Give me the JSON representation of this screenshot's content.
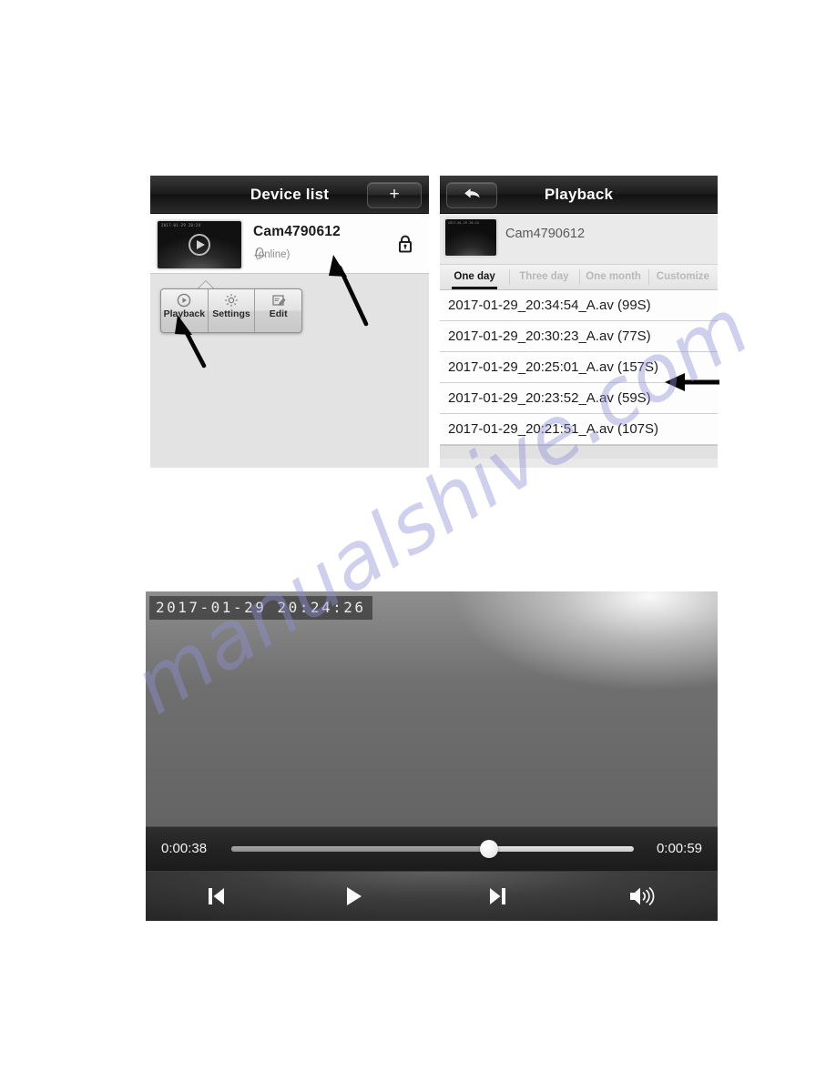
{
  "watermark": {
    "text": "manualshive.com"
  },
  "device_list": {
    "title": "Device list",
    "add_button_label": "+",
    "device": {
      "name": "Cam4790612",
      "status": "(online)",
      "thumb_timestamp": "2017-01-29 20:24",
      "bell_icon": "bell-icon",
      "lock_icon": "lock-icon",
      "play_icon": "play-circle-icon"
    },
    "context_menu": [
      {
        "label": "Playback",
        "icon": "play-circle-icon"
      },
      {
        "label": "Settings",
        "icon": "gear-icon"
      },
      {
        "label": "Edit",
        "icon": "edit-pencil-icon"
      }
    ]
  },
  "playback": {
    "title": "Playback",
    "back_icon": "back-arrow-icon",
    "device": {
      "name": "Cam4790612",
      "thumb_timestamp": "2017-01-29 20:24"
    },
    "tabs": [
      {
        "label": "One day",
        "active": true
      },
      {
        "label": "Three day",
        "active": false
      },
      {
        "label": "One month",
        "active": false
      },
      {
        "label": "Customize",
        "active": false
      }
    ],
    "files": [
      {
        "name": "2017-01-29_20:34:54_A.av (99S)"
      },
      {
        "name": "2017-01-29_20:30:23_A.av (77S)"
      },
      {
        "name": "2017-01-29_20:25:01_A.av (157S)"
      },
      {
        "name": "2017-01-29_20:23:52_A.av (59S)"
      },
      {
        "name": "2017-01-29_20:21:51_A.av (107S)"
      }
    ]
  },
  "player": {
    "overlay_timestamp": "2017-01-29  20:24:26",
    "current_time": "0:00:38",
    "total_time": "0:00:59",
    "progress_percent": 64,
    "controls": [
      {
        "name": "previous-button",
        "icon": "skip-previous-icon"
      },
      {
        "name": "play-button",
        "icon": "play-icon"
      },
      {
        "name": "next-button",
        "icon": "skip-next-icon"
      },
      {
        "name": "volume-button",
        "icon": "volume-icon"
      }
    ]
  }
}
